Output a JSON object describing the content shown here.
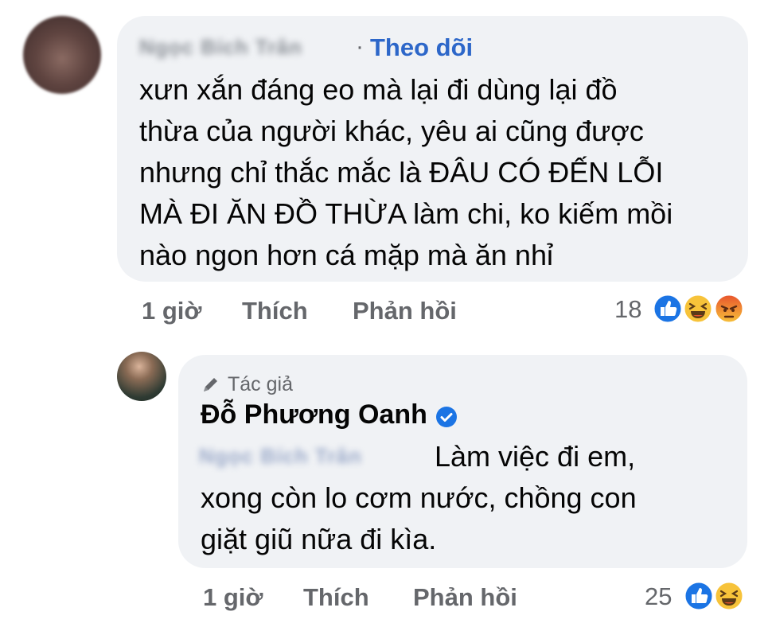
{
  "comment": {
    "author": "Ngọc Bích Trân",
    "follow_label": "Theo dõi",
    "separator": "·",
    "lines": [
      "xưn xắn đáng eo mà lại đi dùng lại đồ",
      "thừa của người khác, yêu ai cũng được",
      "nhưng chỉ thắc mắc là ĐÂU CÓ ĐẾN LỖI",
      "MÀ ĐI ĂN ĐỒ THỪA làm chi, ko kiếm mồi",
      "nào ngon hơn cá mặp mà ăn nhỉ"
    ],
    "time": "1 giờ",
    "like_label": "Thích",
    "reply_label": "Phản hồi",
    "reaction_count": "18",
    "reactions": [
      "like-icon",
      "haha-icon",
      "angry-icon"
    ]
  },
  "reply": {
    "badge": "Tác giả",
    "author": "Đỗ Phương Oanh",
    "mention": "Ngọc Bích Trân",
    "lines": [
      "Làm việc đi em,",
      "xong còn lo cơm nước, chồng con",
      "giặt giũ nữa đi kìa."
    ],
    "time": "1 giờ",
    "like_label": "Thích",
    "reply_label": "Phản hồi",
    "reaction_count": "25",
    "reactions": [
      "like-icon",
      "haha-icon"
    ]
  },
  "colors": {
    "bubble": "#f0f2f5",
    "follow": "#2d67c9",
    "meta": "#65676b",
    "like": "#1b74e4",
    "haha": "#f7c33a",
    "angry": "#e8522c"
  }
}
